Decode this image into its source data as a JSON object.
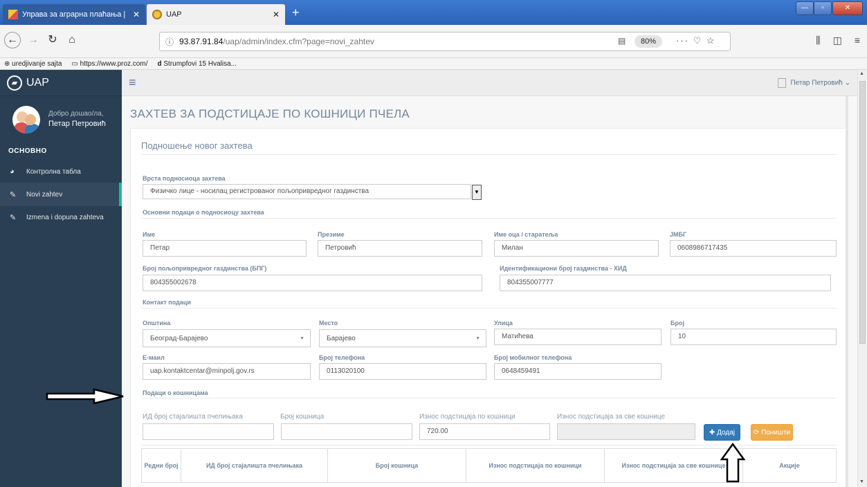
{
  "browser": {
    "tabs": [
      {
        "title": "Управа за аграрна плаћања |",
        "active": false
      },
      {
        "title": "UAP",
        "active": true
      }
    ],
    "url_host": "93.87.91.84",
    "url_path": "/uap/admin/index.cfm?page=novi_zahtev",
    "zoom": "80%",
    "bookmarks": [
      "uredjivanje sajta",
      "https://www.proz.com/",
      "Strumpfovi 15 Hvalisa..."
    ]
  },
  "app": {
    "brand": "UAP",
    "welcome": "Добро дошао/ла,",
    "user_name": "Петар Петровић",
    "user_menu": "Петар Петровић ⌄",
    "section_label": "ОСНОВНО",
    "menu": [
      {
        "label": "Контролна табла",
        "icon": "dashboard-icon"
      },
      {
        "label": "Novi zahtev",
        "icon": "edit-icon"
      },
      {
        "label": "Izmena i dopuna zahteva",
        "icon": "edit-icon"
      }
    ]
  },
  "page": {
    "title": "ЗАХТЕВ ЗА ПОДСТИЦАЈЕ ПО КОШНИЦИ ПЧЕЛА",
    "panel_title": "Подношење новог захтева",
    "applicant_type": {
      "label": "Врста подносиоца захтева",
      "value": "Физичко лице - носилац регистрованог пољопривредног газдинства"
    },
    "basic_section": "Основни подаци о подносиоцу захтева",
    "fields": {
      "first_name": {
        "label": "Име",
        "value": "Петар"
      },
      "last_name": {
        "label": "Презиме",
        "value": "Петровић"
      },
      "parent_name": {
        "label": "Име оца / старатеља",
        "value": "Милан"
      },
      "jmbg": {
        "label": "ЈМБГ",
        "value": "0608986717435"
      },
      "bpg": {
        "label": "Број пољопривредног газдинства (БПГ)",
        "value": "804355002678"
      },
      "hid": {
        "label": "Идентификациони број газдинства - ХИД",
        "value": "804355007777"
      }
    },
    "contact_section": "Контакт подаци",
    "contact": {
      "municipality": {
        "label": "Општина",
        "value": "Београд-Барајево"
      },
      "place": {
        "label": "Место",
        "value": "Барајево"
      },
      "street": {
        "label": "Улица",
        "value": "Матићева"
      },
      "number": {
        "label": "Број",
        "value": "10"
      },
      "email": {
        "label": "Е-маил",
        "value": "uap.kontaktcentar@minpolj.gov.rs"
      },
      "phone": {
        "label": "Број телефона",
        "value": "0113020100"
      },
      "mobile": {
        "label": "Број мобилног телефона",
        "value": "0648459491"
      }
    },
    "hives_section": "Подаци о кошницама",
    "hives": {
      "location_id_label": "ИД број стајалишта пчелињака",
      "hive_count_label": "Број кошница",
      "amount_per_hive_label": "Износ подстицаја по кошници",
      "amount_per_hive_value": "720.00",
      "amount_total_label": "Износ подстицаја за све кошнице",
      "add_button": "Додај",
      "cancel_button": "Поништи"
    },
    "table_headers": [
      "Редни број",
      "ИД број стајалишта пчелињака",
      "Број кошница",
      "Износ подстицаја по кошници",
      "Износ подстицаја за све кошнице",
      "Акције"
    ]
  }
}
